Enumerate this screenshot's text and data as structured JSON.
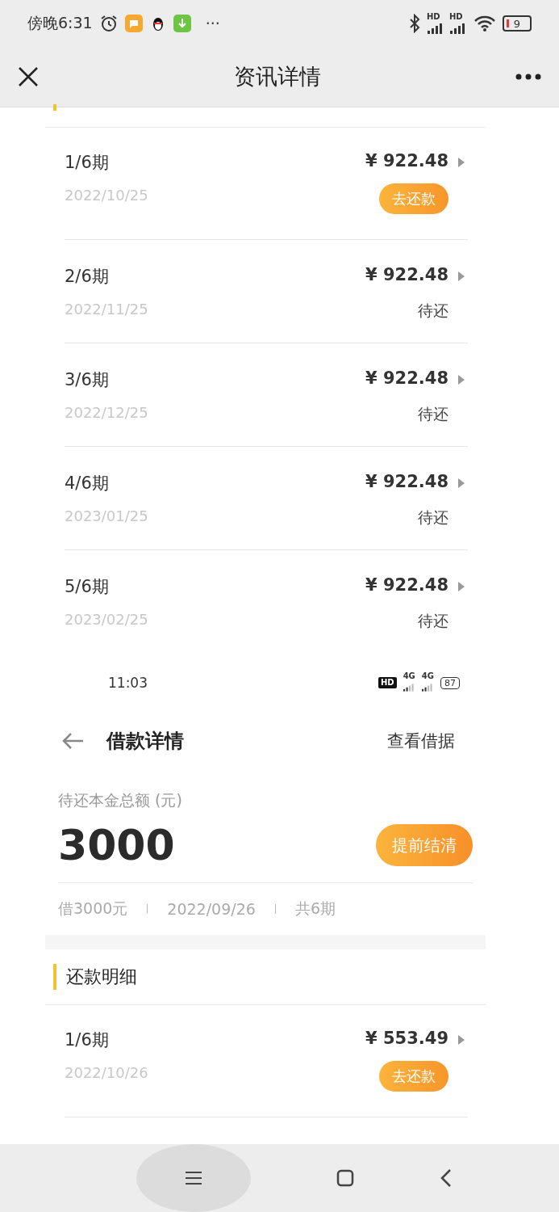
{
  "status_bar": {
    "time": "傍晚6:31",
    "more": "···",
    "signals": [
      {
        "label": "HD"
      },
      {
        "label": "HD"
      }
    ],
    "battery": "9"
  },
  "nav": {
    "title": "资讯详情"
  },
  "outer_rows": [
    {
      "period": "1/6期",
      "date": "2022/10/25",
      "amount": "¥ 922.48",
      "kind": "button",
      "status": "去还款"
    },
    {
      "period": "2/6期",
      "date": "2022/11/25",
      "amount": "¥ 922.48",
      "kind": "text",
      "status": "待还"
    },
    {
      "period": "3/6期",
      "date": "2022/12/25",
      "amount": "¥ 922.48",
      "kind": "text",
      "status": "待还"
    },
    {
      "period": "4/6期",
      "date": "2023/01/25",
      "amount": "¥ 922.48",
      "kind": "text",
      "status": "待还"
    },
    {
      "period": "5/6期",
      "date": "2023/02/25",
      "amount": "¥ 922.48",
      "kind": "text",
      "status": "待还"
    }
  ],
  "inner_status_bar": {
    "time": "11:03",
    "hd": "HD",
    "signals": [
      {
        "label": "4G"
      },
      {
        "label": "4G"
      }
    ],
    "battery": "87"
  },
  "inner_nav": {
    "title": "借款详情",
    "action": "查看借据"
  },
  "summary": {
    "label": "待还本金总额 (元)",
    "amount": "3000",
    "button": "提前结清",
    "meta": [
      "借3000元",
      "2022/09/26",
      "共6期"
    ]
  },
  "section": {
    "title": "还款明细"
  },
  "inner_rows": [
    {
      "period": "1/6期",
      "date": "2022/10/26",
      "amount": "¥ 553.49",
      "kind": "button",
      "status": "去还款"
    }
  ]
}
